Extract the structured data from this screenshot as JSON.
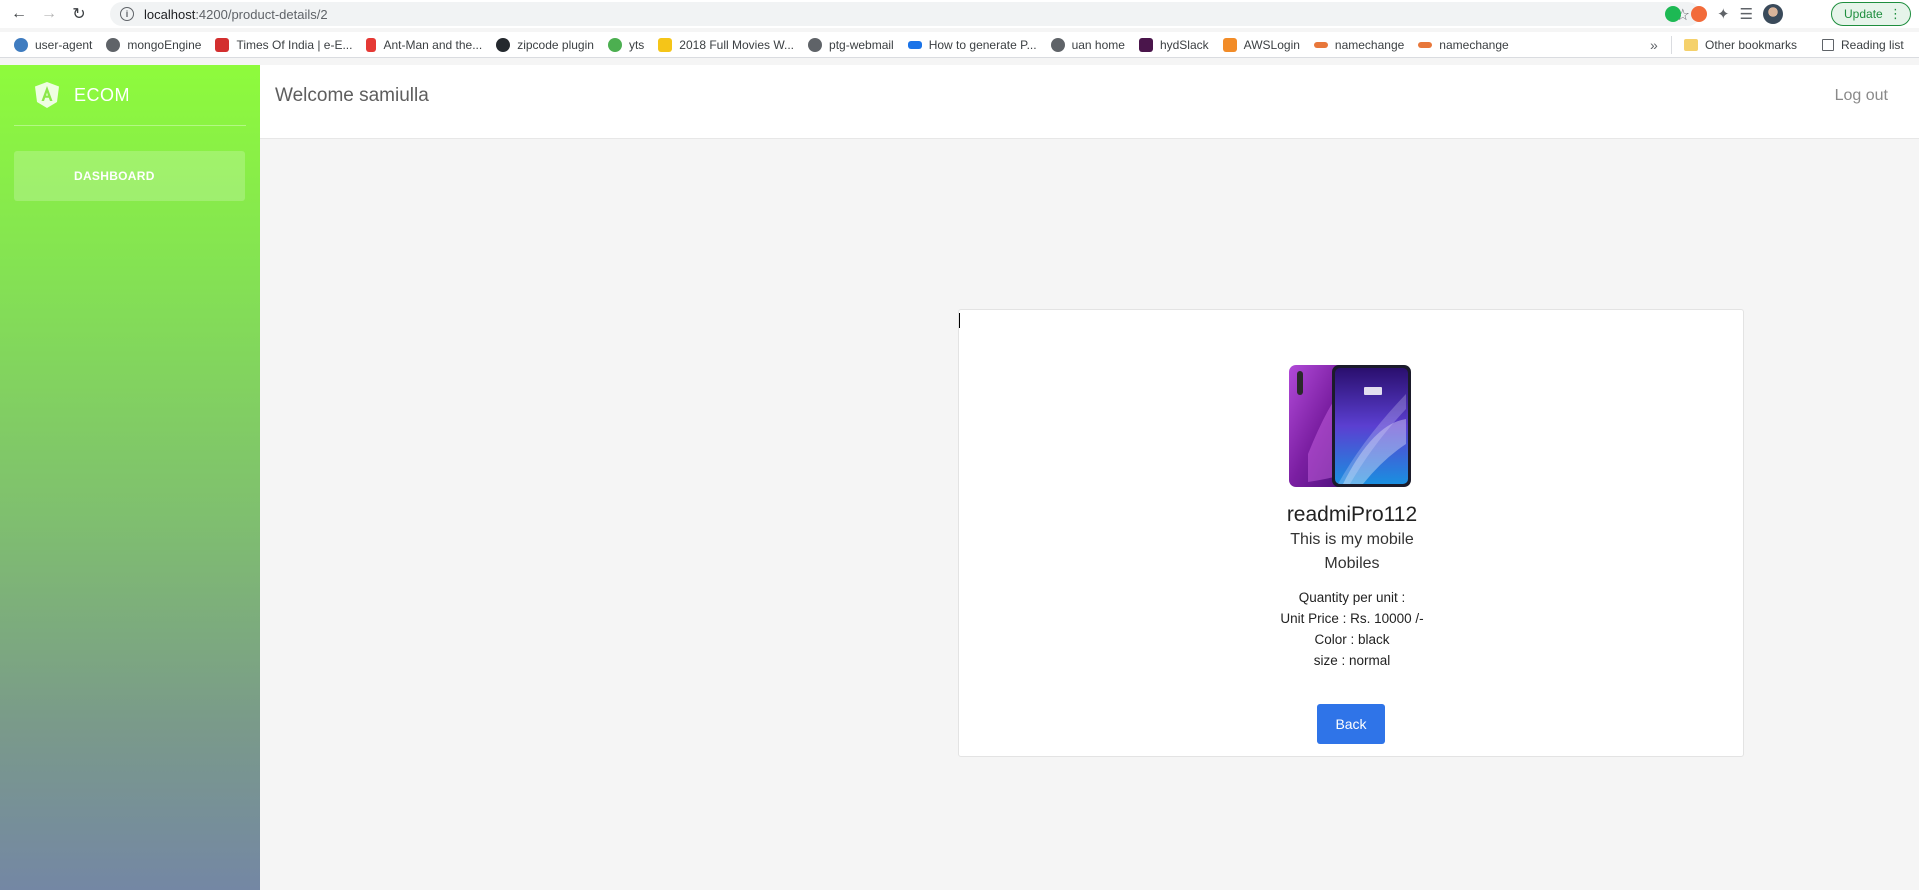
{
  "browser": {
    "url_host": "localhost",
    "url_path": ":4200/product-details/2",
    "update_label": "Update",
    "bookmarks": [
      {
        "label": "user-agent",
        "icon": "python-icon"
      },
      {
        "label": "mongoEngine",
        "icon": "globe-icon"
      },
      {
        "label": "Times Of India | e-E...",
        "icon": "toi-icon"
      },
      {
        "label": "Ant-Man and the...",
        "icon": "site-icon"
      },
      {
        "label": "zipcode plugin",
        "icon": "github-icon"
      },
      {
        "label": "yts",
        "icon": "film-icon"
      },
      {
        "label": "2018 Full Movies W...",
        "icon": "imdb-icon"
      },
      {
        "label": "ptg-webmail",
        "icon": "globe-icon"
      },
      {
        "label": "How to generate P...",
        "icon": "site-icon"
      },
      {
        "label": "uan home",
        "icon": "globe-icon"
      },
      {
        "label": "hydSlack",
        "icon": "slack-icon"
      },
      {
        "label": "AWSLogin",
        "icon": "aws-icon"
      },
      {
        "label": "namechange",
        "icon": "site-icon"
      },
      {
        "label": "namechange",
        "icon": "site-icon"
      }
    ],
    "other_bookmarks": "Other bookmarks",
    "reading_list": "Reading list"
  },
  "app": {
    "brand": "ECOM",
    "menu": {
      "dashboard": "DASHBOARD"
    },
    "header": {
      "welcome": "Welcome samiulla",
      "logout": "Log out"
    },
    "product": {
      "name": "readmiPro112",
      "description": "This is my mobile",
      "category": "Mobiles",
      "quantity_line": "Quantity per unit :",
      "price_line": "Unit Price : Rs. 10000 /-",
      "color_line": "Color : black",
      "size_line": "size : normal"
    },
    "back_label": "Back"
  }
}
